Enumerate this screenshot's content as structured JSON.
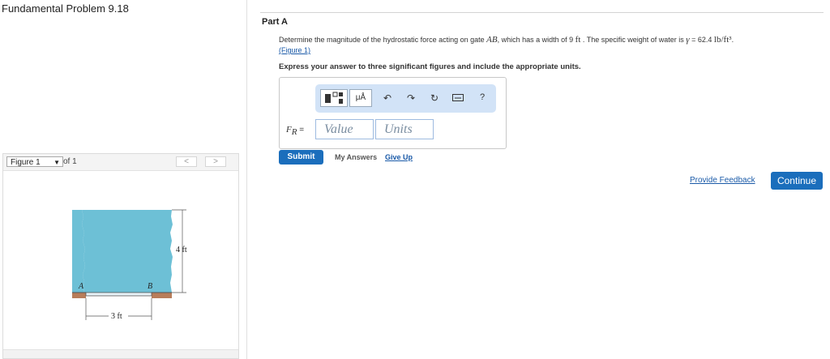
{
  "header": {
    "title": "Fundamental Problem 9.18"
  },
  "figure_panel": {
    "selected": "Figure 1",
    "of_label": "of 1",
    "prev": "<",
    "next": ">",
    "labels": {
      "height": "4 ft",
      "width": "3 ft",
      "point_a": "A",
      "point_b": "B"
    }
  },
  "question": {
    "part": "Part A",
    "text_before": "Determine the magnitude of the hydrostatic force acting on gate ",
    "gate": "AB",
    "text_mid": ", which has a width of 9 ",
    "unit_ft": "ft",
    "text_after": " . The specific weight of water is ",
    "gamma": "γ",
    "text_eq": " = 62.4 ",
    "unit_weight": "lb/ft³",
    "period": ".",
    "figure_link": "(Figure 1)",
    "instruction": "Express your answer to three significant figures and include the appropriate units."
  },
  "answer": {
    "label_f": "F",
    "label_sub": "R",
    "label_eq": " =",
    "value_placeholder": "Value",
    "units_placeholder": "Units",
    "toolbar_mu": "μÅ",
    "toolbar_help": "?"
  },
  "actions": {
    "submit": "Submit",
    "my_answers": "My Answers",
    "give_up": "Give Up",
    "provide_feedback": "Provide Feedback",
    "continue": "Continue"
  },
  "colors": {
    "accent": "#1b6ebc",
    "water": "#6dc0d6",
    "ground": "#b87d5a",
    "toolbar": "#d2e3f7"
  }
}
